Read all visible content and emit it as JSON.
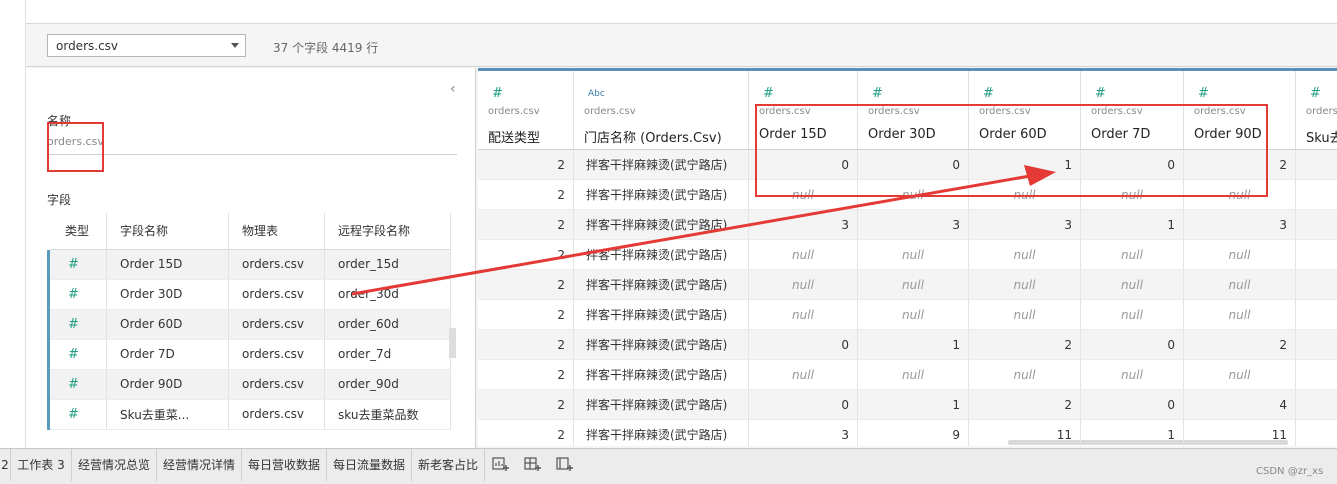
{
  "source": {
    "selected": "orders.csv",
    "info": "37 个字段 4419 行"
  },
  "left_panel": {
    "name_label": "名称",
    "name_value": "orders.csv",
    "fields_label": "字段",
    "collapse_icon": "chevron-left-icon",
    "columns": [
      "类型",
      "字段名称",
      "物理表",
      "远程字段名称"
    ],
    "rows": [
      {
        "type": "#",
        "field": "Order 15D",
        "table": "orders.csv",
        "remote": "order_15d"
      },
      {
        "type": "#",
        "field": "Order 30D",
        "table": "orders.csv",
        "remote": "order_30d"
      },
      {
        "type": "#",
        "field": "Order 60D",
        "table": "orders.csv",
        "remote": "order_60d"
      },
      {
        "type": "#",
        "field": "Order 7D",
        "table": "orders.csv",
        "remote": "order_7d"
      },
      {
        "type": "#",
        "field": "Order 90D",
        "table": "orders.csv",
        "remote": "order_90d"
      },
      {
        "type": "#",
        "field": "Sku去重菜...",
        "table": "orders.csv",
        "remote": "sku去重菜品数"
      }
    ]
  },
  "grid": {
    "columns": [
      {
        "type": "#",
        "src": "orders.csv",
        "name": "配送类型"
      },
      {
        "type": "Abc",
        "src": "orders.csv",
        "name": "门店名称 (Orders.Csv)"
      },
      {
        "type": "#",
        "src": "orders.csv",
        "name": "Order 15D"
      },
      {
        "type": "#",
        "src": "orders.csv",
        "name": "Order 30D"
      },
      {
        "type": "#",
        "src": "orders.csv",
        "name": "Order 60D"
      },
      {
        "type": "#",
        "src": "orders.csv",
        "name": "Order 7D"
      },
      {
        "type": "#",
        "src": "orders.csv",
        "name": "Order 90D"
      },
      {
        "type": "#",
        "src": "orders.csv",
        "name": "Sku去"
      }
    ],
    "rows": [
      [
        "2",
        "拌客干拌麻辣烫(武宁路店)",
        "0",
        "0",
        "1",
        "0",
        "2"
      ],
      [
        "2",
        "拌客干拌麻辣烫(武宁路店)",
        "null",
        "null",
        "null",
        "null",
        "null"
      ],
      [
        "2",
        "拌客干拌麻辣烫(武宁路店)",
        "3",
        "3",
        "3",
        "1",
        "3"
      ],
      [
        "2",
        "拌客干拌麻辣烫(武宁路店)",
        "null",
        "null",
        "null",
        "null",
        "null"
      ],
      [
        "2",
        "拌客干拌麻辣烫(武宁路店)",
        "null",
        "null",
        "null",
        "null",
        "null"
      ],
      [
        "2",
        "拌客干拌麻辣烫(武宁路店)",
        "null",
        "null",
        "null",
        "null",
        "null"
      ],
      [
        "2",
        "拌客干拌麻辣烫(武宁路店)",
        "0",
        "1",
        "2",
        "0",
        "2"
      ],
      [
        "2",
        "拌客干拌麻辣烫(武宁路店)",
        "null",
        "null",
        "null",
        "null",
        "null"
      ],
      [
        "2",
        "拌客干拌麻辣烫(武宁路店)",
        "0",
        "1",
        "2",
        "0",
        "4"
      ],
      [
        "2",
        "拌客干拌麻辣烫(武宁路店)",
        "3",
        "9",
        "11",
        "1",
        "11"
      ]
    ]
  },
  "tabs": [
    "2",
    "工作表 3",
    "经营情况总览",
    "经营情况详情",
    "每日营收数据",
    "每日流量数据",
    "新老客占比"
  ],
  "tab_icons": [
    "new-worksheet-icon",
    "new-dashboard-icon",
    "new-story-icon"
  ],
  "watermark": "CSDN @zr_xs",
  "colors": {
    "annotation": "#e53935",
    "measure_icon": "#1e9e83",
    "header_accent": "#5a8fb6"
  }
}
